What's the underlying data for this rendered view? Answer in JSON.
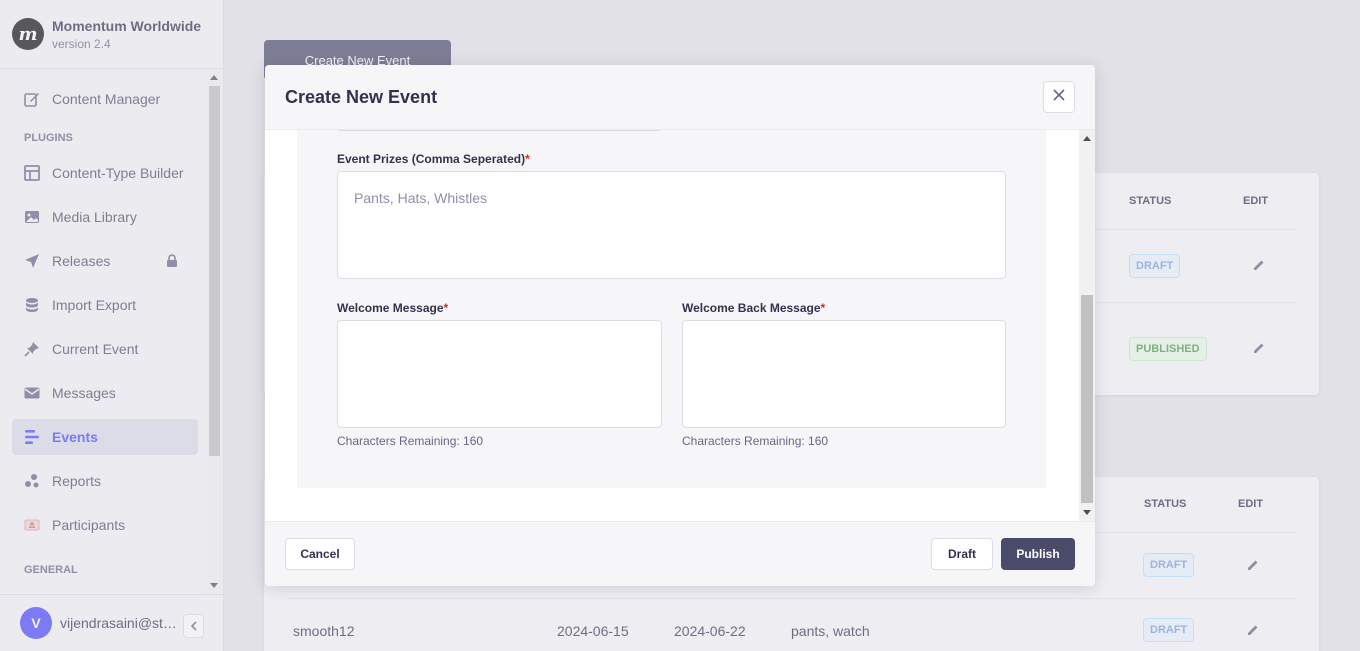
{
  "app": {
    "name": "Momentum Worldwide",
    "version": "version 2.4",
    "logo_letter": "m"
  },
  "sidebar": {
    "content_manager": "Content Manager",
    "plugins_title": "PLUGINS",
    "items": [
      {
        "label": "Content-Type Builder",
        "icon": "layout-icon"
      },
      {
        "label": "Media Library",
        "icon": "image-icon"
      },
      {
        "label": "Releases",
        "icon": "paper-plane-icon"
      },
      {
        "label": "Import Export",
        "icon": "database-icon"
      },
      {
        "label": "Current Event",
        "icon": "pin-icon"
      },
      {
        "label": "Messages",
        "icon": "envelope-icon"
      },
      {
        "label": "Events",
        "icon": "list-icon"
      },
      {
        "label": "Reports",
        "icon": "chart-bubbles-icon"
      },
      {
        "label": "Participants",
        "icon": "id-card-icon"
      }
    ],
    "active": "Events",
    "general_title": "GENERAL"
  },
  "user": {
    "initial": "V",
    "name": "vijendrasaini@sta..."
  },
  "background": {
    "create_button": "Create New Event",
    "table1": {
      "headers": {
        "status": "STATUS",
        "edit": "EDIT"
      },
      "rows": [
        {
          "status": "DRAFT"
        },
        {
          "status": "PUBLISHED"
        }
      ]
    },
    "table2": {
      "headers": {
        "status": "STATUS",
        "edit": "EDIT"
      },
      "rows": [
        {
          "status": "DRAFT"
        },
        {
          "name": "smooth12",
          "start": "2024-06-15",
          "end": "2024-06-22",
          "prizes": "pants, watch",
          "status": "DRAFT"
        }
      ]
    }
  },
  "modal": {
    "title": "Create New Event",
    "fields": {
      "prizes": {
        "label": "Event Prizes (Comma Seperated)",
        "required": "*",
        "placeholder": "Pants, Hats, Whistles"
      },
      "welcome": {
        "label": "Welcome Message",
        "required": "*",
        "hint": "Characters Remaining: 160"
      },
      "welcome_back": {
        "label": "Welcome Back Message",
        "required": "*",
        "hint": "Characters Remaining: 160"
      }
    },
    "buttons": {
      "cancel": "Cancel",
      "draft": "Draft",
      "publish": "Publish"
    }
  }
}
